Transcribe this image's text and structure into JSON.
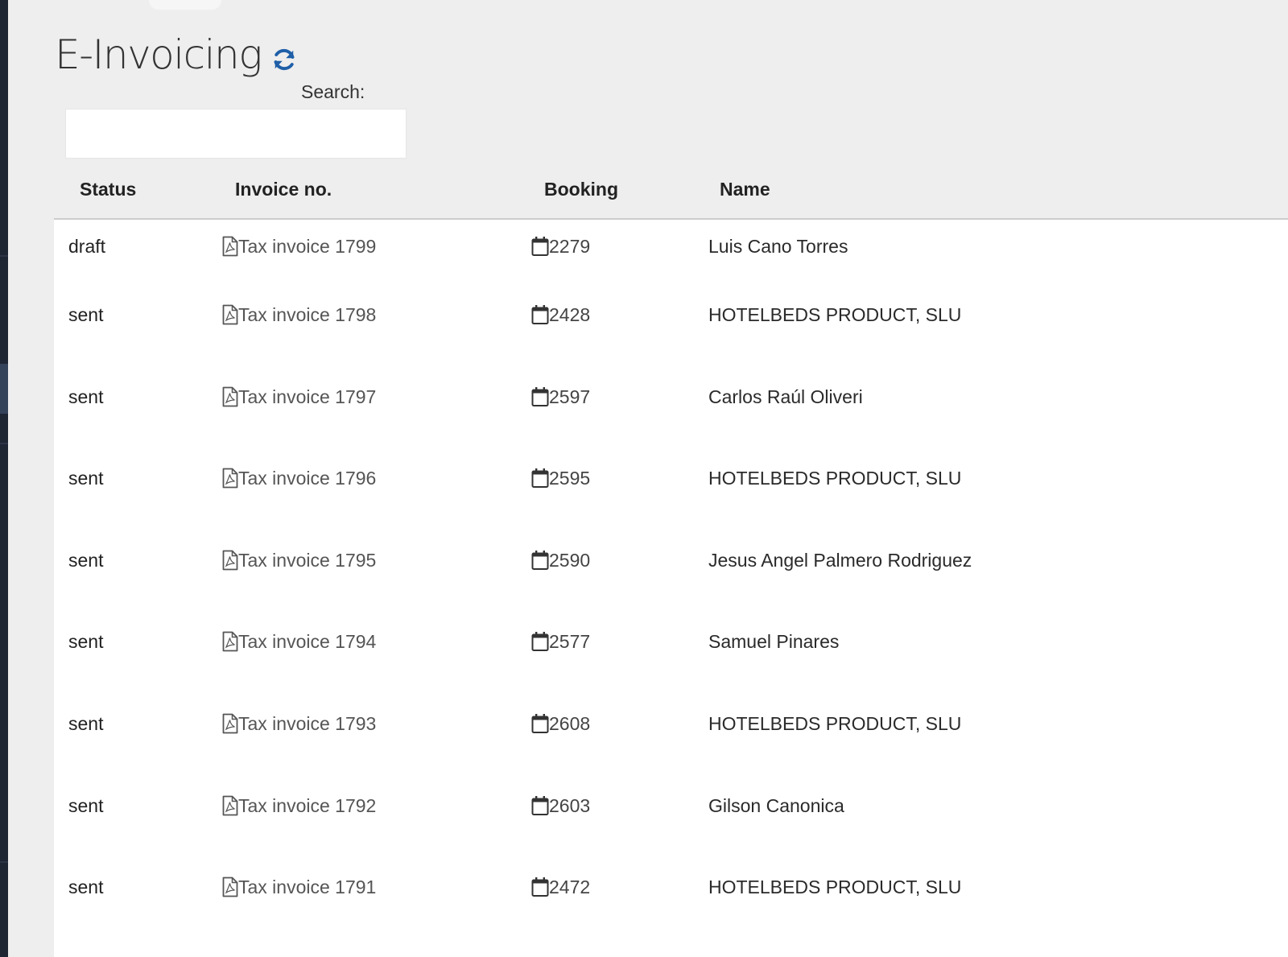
{
  "header": {
    "title": "E-Invoicing",
    "refresh_icon": "refresh-icon"
  },
  "search": {
    "label": "Search:",
    "value": "",
    "placeholder": ""
  },
  "table": {
    "columns": [
      "Status",
      "Invoice no.",
      "Booking",
      "Name"
    ],
    "rows": [
      {
        "status": "draft",
        "invoice": "Tax invoice 1799",
        "booking": "2279",
        "name": "Luis Cano Torres"
      },
      {
        "status": "sent",
        "invoice": "Tax invoice 1798",
        "booking": "2428",
        "name": "HOTELBEDS PRODUCT, SLU"
      },
      {
        "status": "sent",
        "invoice": "Tax invoice 1797",
        "booking": "2597",
        "name": "Carlos Raúl Oliveri"
      },
      {
        "status": "sent",
        "invoice": "Tax invoice 1796",
        "booking": "2595",
        "name": "HOTELBEDS PRODUCT, SLU"
      },
      {
        "status": "sent",
        "invoice": "Tax invoice 1795",
        "booking": "2590",
        "name": "Jesus Angel Palmero Rodriguez"
      },
      {
        "status": "sent",
        "invoice": "Tax invoice 1794",
        "booking": "2577",
        "name": "Samuel Pinares"
      },
      {
        "status": "sent",
        "invoice": "Tax invoice 1793",
        "booking": "2608",
        "name": "HOTELBEDS PRODUCT, SLU"
      },
      {
        "status": "sent",
        "invoice": "Tax invoice 1792",
        "booking": "2603",
        "name": "Gilson Canonica"
      },
      {
        "status": "sent",
        "invoice": "Tax invoice 1791",
        "booking": "2472",
        "name": "HOTELBEDS PRODUCT, SLU"
      }
    ],
    "invoice_icon": "pdf-file-icon",
    "booking_icon": "calendar-icon"
  },
  "colors": {
    "accent": "#1f5fa8",
    "background": "#eeeeee",
    "sidebar": "#1e2533"
  }
}
